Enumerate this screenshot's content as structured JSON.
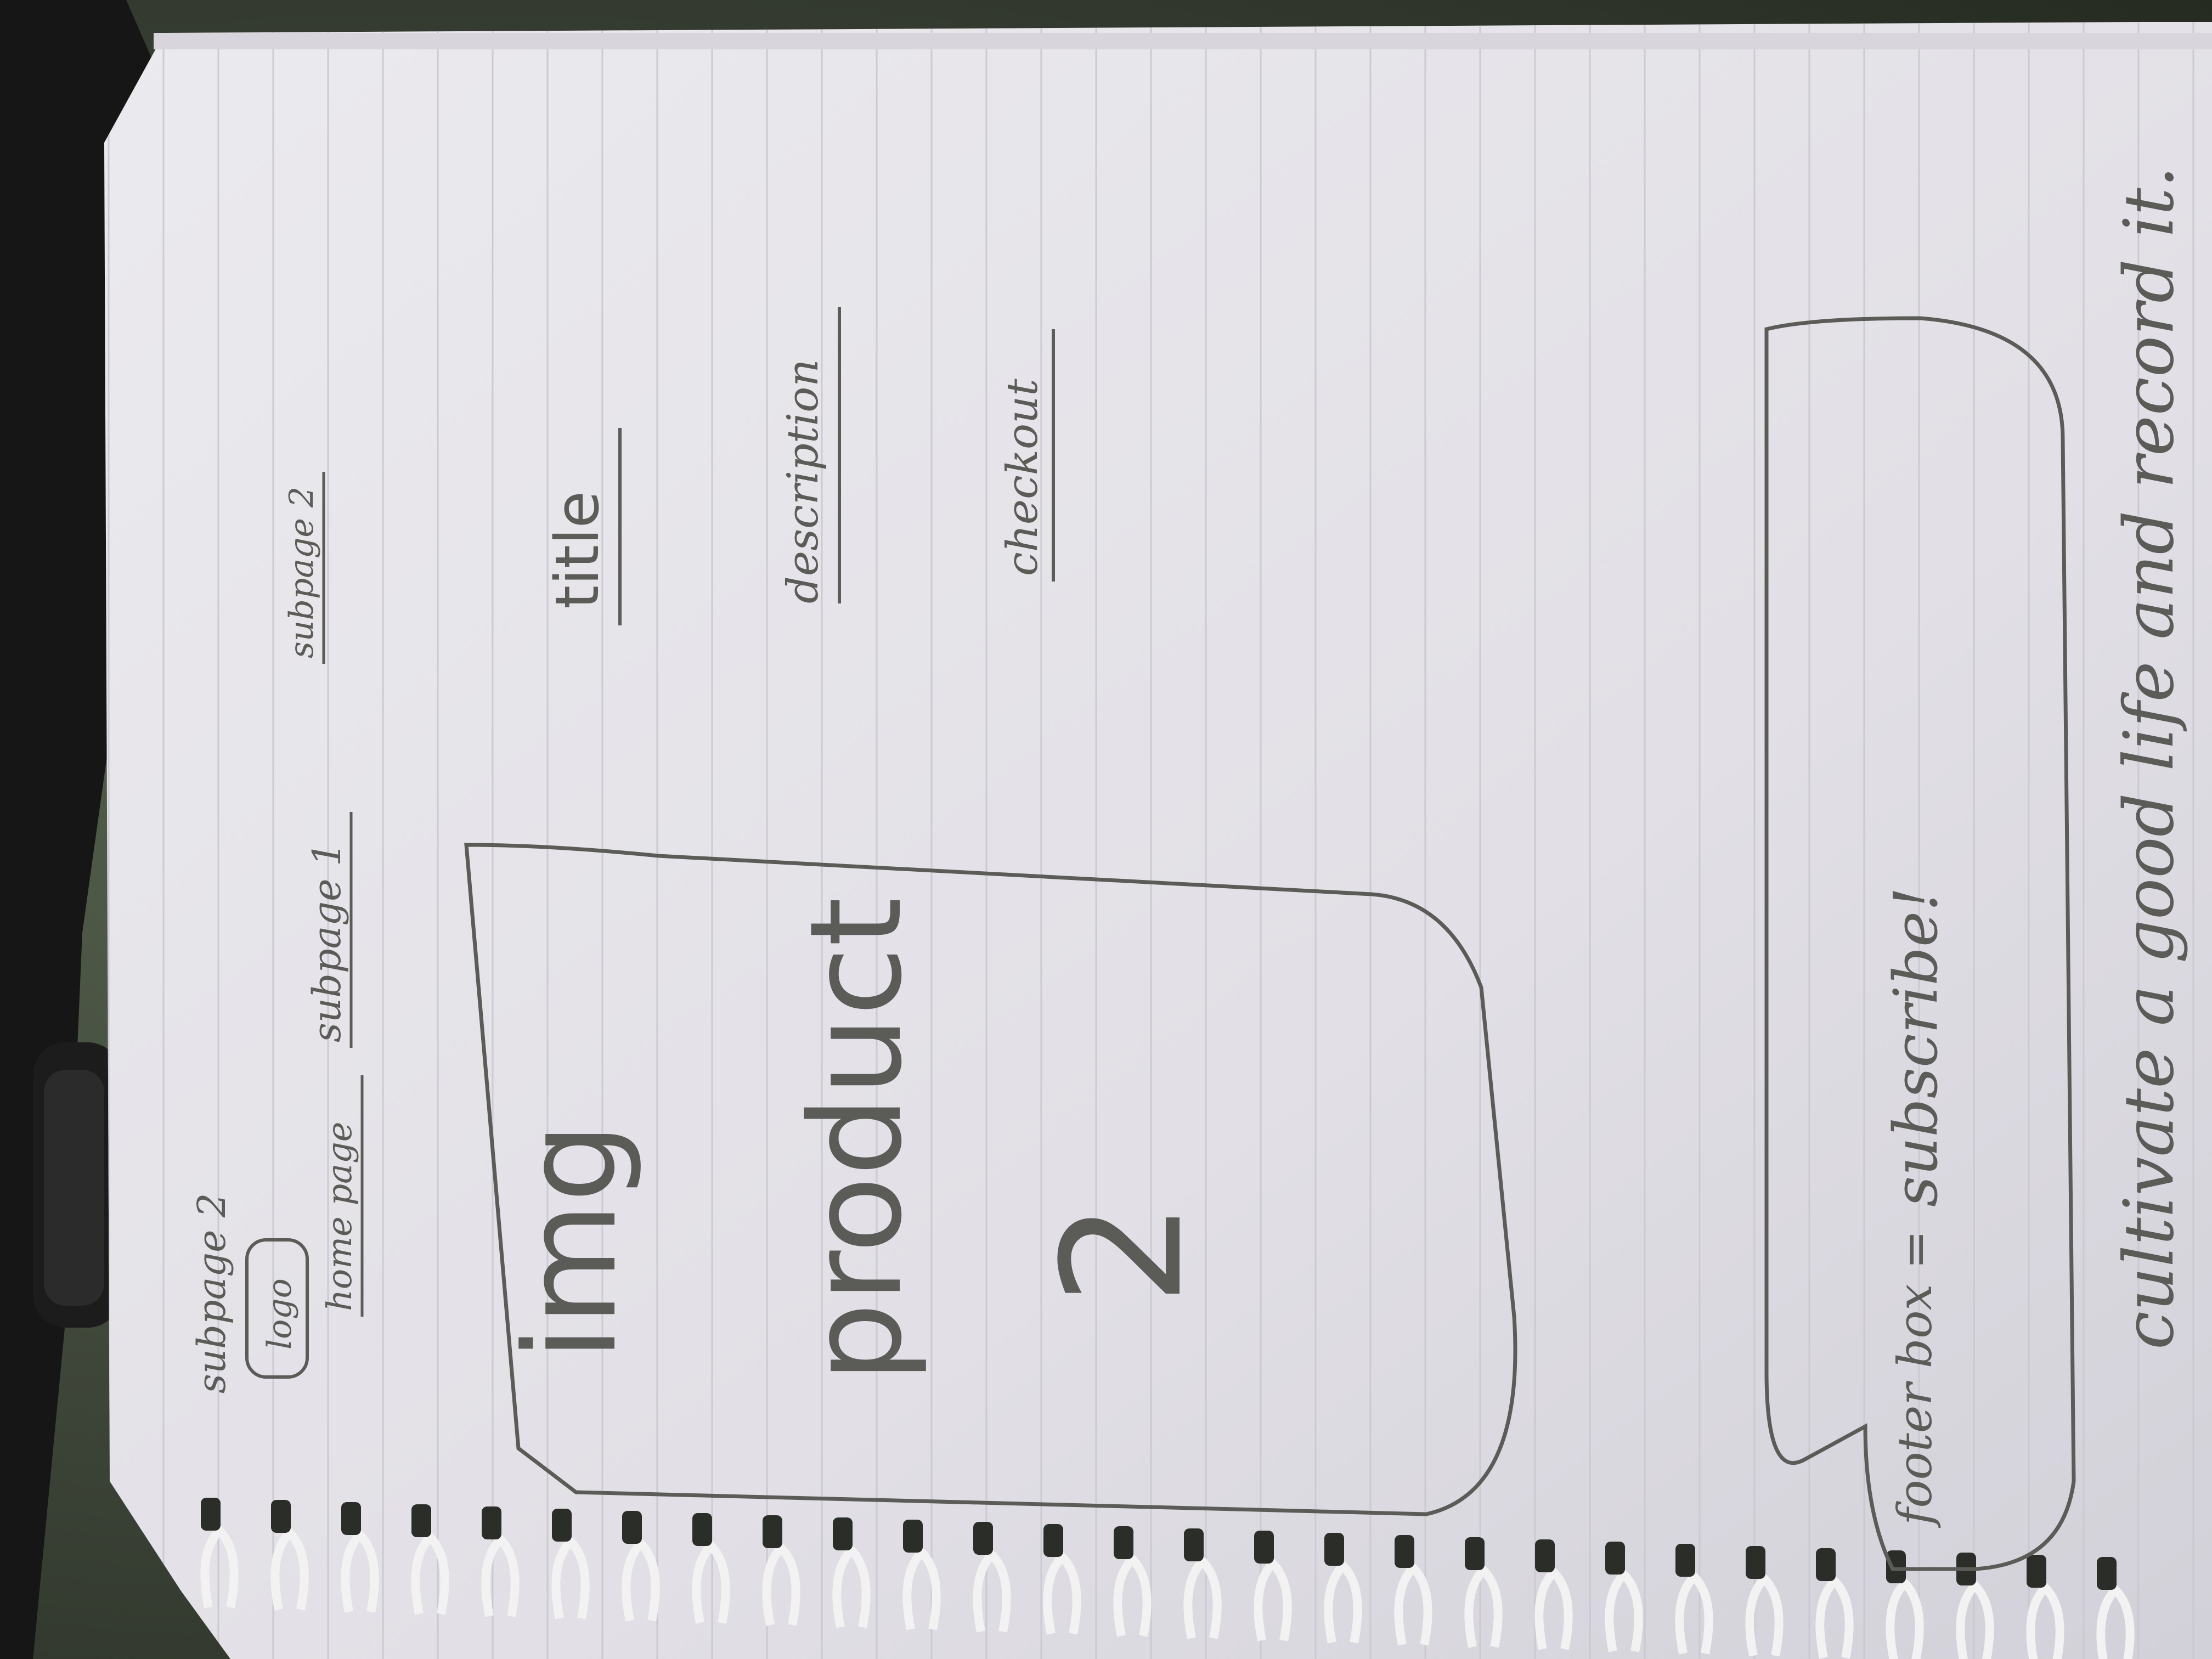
{
  "sketch": {
    "header_note": "subpage 2",
    "logo": "logo",
    "nav": {
      "home": "home page",
      "subpage1": "subpage 1",
      "subpage2": "subpage 2"
    },
    "image_placeholder": "img",
    "product_label": "product",
    "product_number": "2",
    "title": "title",
    "description": "description",
    "checkout": "checkout",
    "footer_label": "footer box =",
    "footer_cta": "subscribe!",
    "tagline": "cultivate a good life and record it."
  },
  "colors": {
    "paper": "#e6e4e8",
    "ink": "#5b5b58",
    "rule_line": "#c9c7cf",
    "background": "#3b4236",
    "spiral": "#f2f2f2"
  }
}
